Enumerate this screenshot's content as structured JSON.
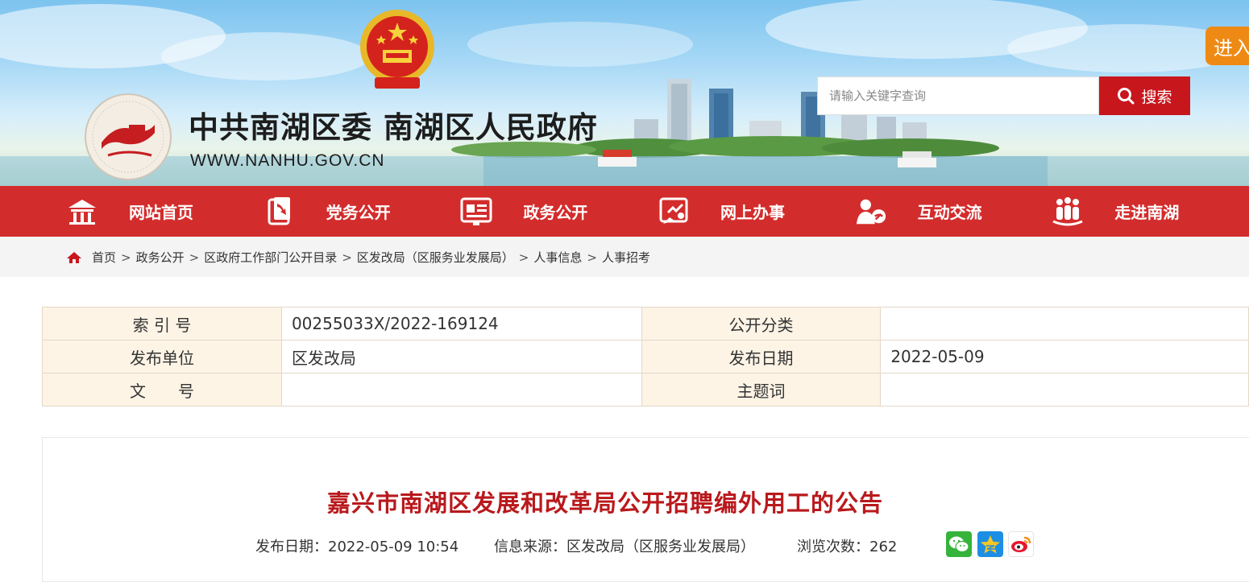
{
  "header": {
    "title": "中共南湖区委 南湖区人民政府",
    "url": "WWW.NANHU.GOV.CN",
    "search_placeholder": "请输入关键字查询",
    "search_label": "搜索",
    "enter_label": "进入"
  },
  "nav": {
    "items": [
      {
        "label": "网站首页",
        "icon": "home-gate-icon"
      },
      {
        "label": "党务公开",
        "icon": "party-flag-icon"
      },
      {
        "label": "政务公开",
        "icon": "document-board-icon"
      },
      {
        "label": "网上办事",
        "icon": "online-service-icon"
      },
      {
        "label": "互动交流",
        "icon": "interaction-icon"
      },
      {
        "label": "走进南湖",
        "icon": "people-group-icon"
      }
    ]
  },
  "breadcrumb": [
    "首页",
    "政务公开",
    "区政府工作部门公开目录",
    "区发改局（区服务业发展局）",
    "人事信息",
    "人事招考"
  ],
  "info": {
    "index_label": "索 引 号",
    "index_value": "00255033X/2022-169124",
    "category_label": "公开分类",
    "category_value": "",
    "publisher_label": "发布单位",
    "publisher_value": "区发改局",
    "date_label": "发布日期",
    "date_value": "2022-05-09",
    "doc_label": "文　　号",
    "doc_value": "",
    "subject_label": "主题词",
    "subject_value": ""
  },
  "article": {
    "title": "嘉兴市南湖区发展和改革局公开招聘编外用工的公告",
    "date_label": "发布日期：",
    "date_value": "2022-05-09 10:54",
    "source_label": "信息来源：",
    "source_value": "区发改局（区服务业发展局）",
    "views_label": "浏览次数：",
    "views_value": "262"
  },
  "share": [
    "wechat-icon",
    "qzone-icon",
    "weibo-icon"
  ],
  "colors": {
    "brand_red": "#d32c2c",
    "title_red": "#b9191c",
    "enter_orange": "#ee8a14",
    "table_key_bg": "#fdf4e6"
  }
}
